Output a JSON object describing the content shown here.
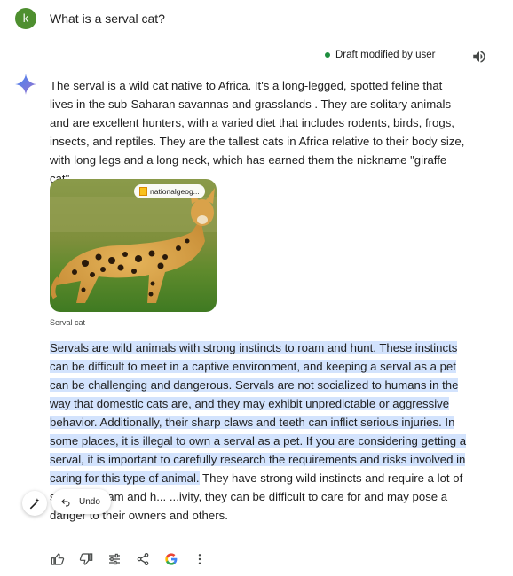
{
  "user": {
    "avatar_letter": "k",
    "avatar_color": "#4e8f2f",
    "query": "What is a serval cat?"
  },
  "response": {
    "draft_status": "Draft modified by user",
    "paragraph1": "The serval is a wild cat native to Africa. It's a long-legged, spotted feline that lives in the sub-Saharan savannas and grasslands .  They are solitary animals and are excellent hunters, with a varied diet that includes rodents, birds, frogs, insects, and reptiles.  They are the tallest cats in Africa relative to their body size, with long legs and a long neck, which has earned them the nickname \"giraffe cat\".",
    "image": {
      "source": "nationalgeog...",
      "caption": "Serval cat"
    },
    "paragraph2_highlighted": "Servals are wild animals with strong instincts to roam and hunt.  These instincts can be difficult to meet in a captive environment, and keeping a serval as a pet can be challenging and dangerous.  Servals are not socialized to humans in the way that domestic cats are, and they may exhibit unpredictable or aggressive behavior.  Additionally, their sharp claws and teeth can inflict serious injuries.  In some places, it is illegal to own a serval as a pet.  If you are considering getting a serval, it is important to carefully research the requirements and risks involved in caring for this type of animal.",
    "paragraph2_rest": " They have strong wild instincts and require a lot of space to roam and h... ...ivity, they can be difficult to care for and may pose a danger to their owners and others.",
    "highlight_color": "#d3e3fd"
  },
  "floating": {
    "undo_label": "Undo"
  },
  "actions": {
    "icons": [
      "thumbs-up-icon",
      "thumbs-down-icon",
      "modify-response-icon",
      "share-icon",
      "google-icon",
      "more-vert-icon"
    ]
  }
}
